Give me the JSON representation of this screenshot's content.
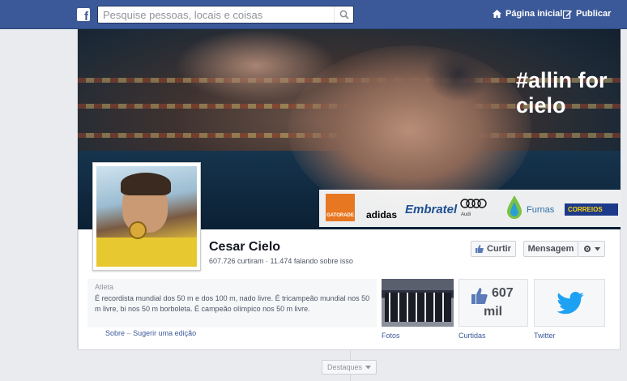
{
  "topbar": {
    "search_placeholder": "Pesquise pessoas, locais e coisas",
    "home_label": "Página inicial",
    "publish_label": "Publicar"
  },
  "cover": {
    "hashtag": "#allin for cielo",
    "sponsors": [
      "GATORADE",
      "adidas",
      "Embratel",
      "Audi",
      "Furnas",
      "CORREIOS"
    ]
  },
  "profile": {
    "name": "Cesar Cielo",
    "likes_line": "607.726 curtiram · 11.474 falando sobre isso",
    "like_button": "Curtir",
    "message_button": "Mensagem"
  },
  "about": {
    "category": "Atleta",
    "text": "É recordista mundial dos 50 m e dos 100 m, nado livre. É tricampeão mundial nos 50 m livre, bi nos 50 m borboleta. É campeão olímpico nos 50 m livre.",
    "link_about": "Sobre",
    "separator": "–",
    "link_suggest": "Sugerir uma edição"
  },
  "tiles": {
    "photos_label": "Fotos",
    "likes_count_top": "607",
    "likes_count_bottom": "mil",
    "likes_label": "Curtidas",
    "twitter_label": "Twitter"
  },
  "timeline": {
    "highlights_label": "Destaques"
  },
  "colors": {
    "brand": "#3b5998",
    "twitter": "#1da1f2"
  }
}
